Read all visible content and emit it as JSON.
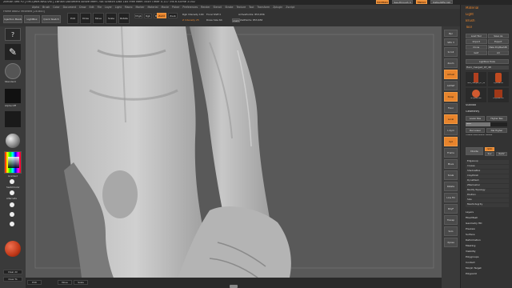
{
  "title_bar": {
    "text": "ZBrush 4R6 P2 [TIM-QWM-NRD-VKT]   ZBrush Document   Active Mem 748 Scratch Disk 185 Free Mem 3549 Timer 0.117 Tris 6 ATime 3.002",
    "buttons": [
      "QuickSave",
      "See-through 0",
      "Menus",
      "DefaultZScript"
    ]
  },
  "menu_bar": {
    "items": [
      "Alpha",
      "Brush",
      "Color",
      "Document",
      "Draw",
      "Edit",
      "File",
      "Layer",
      "Light",
      "Macro",
      "Marker",
      "Material",
      "Movie",
      "Picker",
      "Preferences",
      "Render",
      "Stencil",
      "Stroke",
      "Texture",
      "Tool",
      "Transform",
      "Zplugin",
      "Zscript"
    ],
    "status": "Frame 86852 recorded  [240x43]"
  },
  "top_toolbar": {
    "projection_master": "Projection Master",
    "lightbox": "LightBox",
    "quick_sketch": "Quick Sketch",
    "edit": "Edit",
    "draw": "Draw",
    "move": "Move",
    "scale": "Scale",
    "rotate": "Rotate",
    "mrgb": "Mrgb",
    "rgb": "Rgb",
    "m": "M",
    "zadd": "Zadd",
    "zsub": "Zsub",
    "rgb_intensity": "Rgb Intensity 100",
    "z_intensity": "Z Intensity 25",
    "focal_shift": "Focal Shift 0",
    "draw_size": "Draw Size 64",
    "active_points": "ActivePoints: 853,656",
    "total_points": "TotalPoints: 853,656",
    "dynamic": "Dynamic"
  },
  "left_shelf": {
    "brush_label": "Standard",
    "stroke_label": "Dots",
    "alpha_label": "Alpha Off",
    "texture_label": "Texture Off",
    "material_label": "MatCap Gray",
    "gradient": "Gradient",
    "switch_color": "SwitchColor",
    "alternate": "Alternate",
    "clear_all": "Clear All",
    "clear_to": "Clear To"
  },
  "right_shelf_buttons": [
    "Bpr",
    "SPix 3",
    "Scroll",
    "Zoom",
    "Actual",
    "AAHalf",
    "Persp",
    "Floor",
    "Local",
    "L.Sym",
    "Xyz",
    "Frame",
    "Move",
    "Scale",
    "Rotate",
    "Line Fill",
    "PolyF",
    "Transp",
    "Solo",
    "Xpose"
  ],
  "right_panel": {
    "menus": [
      "Material",
      "Light",
      "Brush",
      "Tool"
    ],
    "tool_buttons": [
      "Load Tool",
      "Save As",
      "Import",
      "Export",
      "Clone",
      "Make PolyMesh3D",
      "GoZ",
      "All",
      "Visible",
      "R",
      "Lightbox Tools"
    ],
    "current_tool": "Hero_merged_07_48",
    "subtools": [
      {
        "label": "Hero_merged_07_48",
        "color": "#b04020"
      },
      {
        "label": "Cylinder3D",
        "color": "#c04a20"
      },
      {
        "label": "SimpleBrush",
        "color": "#d05a30"
      },
      {
        "label": "PolyMesh3D",
        "color": "#a03818"
      }
    ],
    "subtool_header": "SubTool",
    "geometry": "Geometry",
    "lower_res": "Lower Res",
    "higher_res": "Higher Res",
    "sdiv_label": "SDiv",
    "del_lower": "Del Lower",
    "del_higher": "Del Higher",
    "freeze_subdiv": "Freeze Subdivision Levels",
    "divide": "Divide",
    "smt": "Smt",
    "suv": "Suv",
    "reuv": "ReUV",
    "geometry_items": [
      "EdgeLoop",
      "Crease",
      "ShadowBox",
      "ClayPolish",
      "DynaMesh",
      "ZRemesher",
      "Modify Topology",
      "Position",
      "Size",
      "MeshIntegrity"
    ],
    "sections": [
      "Layers",
      "FiberMesh",
      "Geometry HD",
      "Preview",
      "Surface",
      "Deformation",
      "Masking",
      "Visibility",
      "Polygroups",
      "Contact",
      "Morph Target",
      "Polypaint"
    ]
  },
  "bottom_bar": {
    "item1": "Edit",
    "item2": "Move",
    "item3": "Scale"
  },
  "colors": {
    "accent": "#e8842c",
    "bg_dark": "#2e2e2e",
    "panel": "#3a3a3a",
    "canvas": "#5c5c5c"
  }
}
